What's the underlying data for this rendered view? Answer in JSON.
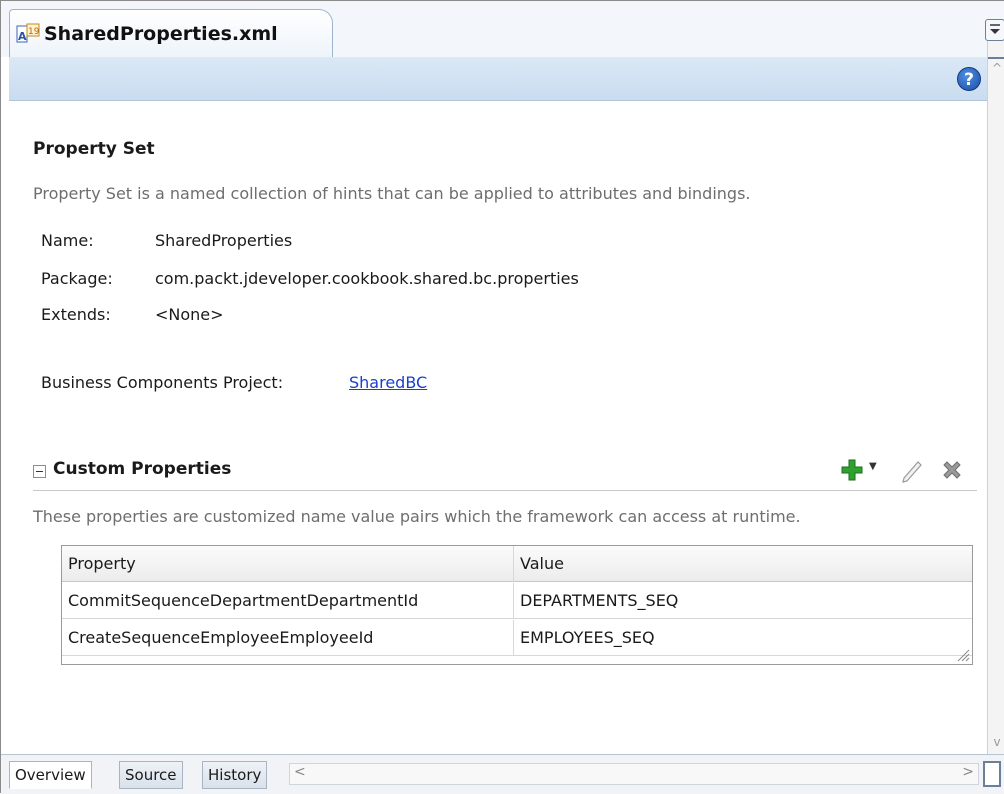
{
  "editor_tab": {
    "title": "SharedProperties.xml",
    "icon": "xml-file-icon"
  },
  "toolbar": {
    "help_icon": "help-icon",
    "help_label": "?"
  },
  "property_set": {
    "title": "Property Set",
    "description": "Property Set is a named collection of hints that can be applied to attributes and bindings.",
    "fields": {
      "name_label": "Name:",
      "name_value": "SharedProperties",
      "package_label": "Package:",
      "package_value": "com.packt.jdeveloper.cookbook.shared.bc.properties",
      "extends_label": "Extends:",
      "extends_value": "<None>"
    },
    "project_label": "Business Components Project:",
    "project_link": "SharedBC"
  },
  "custom_properties": {
    "title": "Custom Properties",
    "description": "These properties are customized name value pairs which the framework can access at runtime.",
    "actions": {
      "add": "add-icon",
      "edit": "edit-icon",
      "delete": "delete-icon"
    },
    "columns": [
      "Property",
      "Value"
    ],
    "rows": [
      {
        "property": "CommitSequenceDepartmentDepartmentId",
        "value": "DEPARTMENTS_SEQ"
      },
      {
        "property": "CreateSequenceEmployeeEmployeeId",
        "value": "EMPLOYEES_SEQ"
      }
    ]
  },
  "bottom_tabs": [
    {
      "label": "Overview",
      "active": true
    },
    {
      "label": "Source",
      "active": false
    },
    {
      "label": "History",
      "active": false
    }
  ],
  "colors": {
    "link": "#1a3fd0",
    "toolbar_band": "#c9dcef",
    "add_green": "#2fa12f",
    "delete_gray": "#8a8a8a"
  }
}
